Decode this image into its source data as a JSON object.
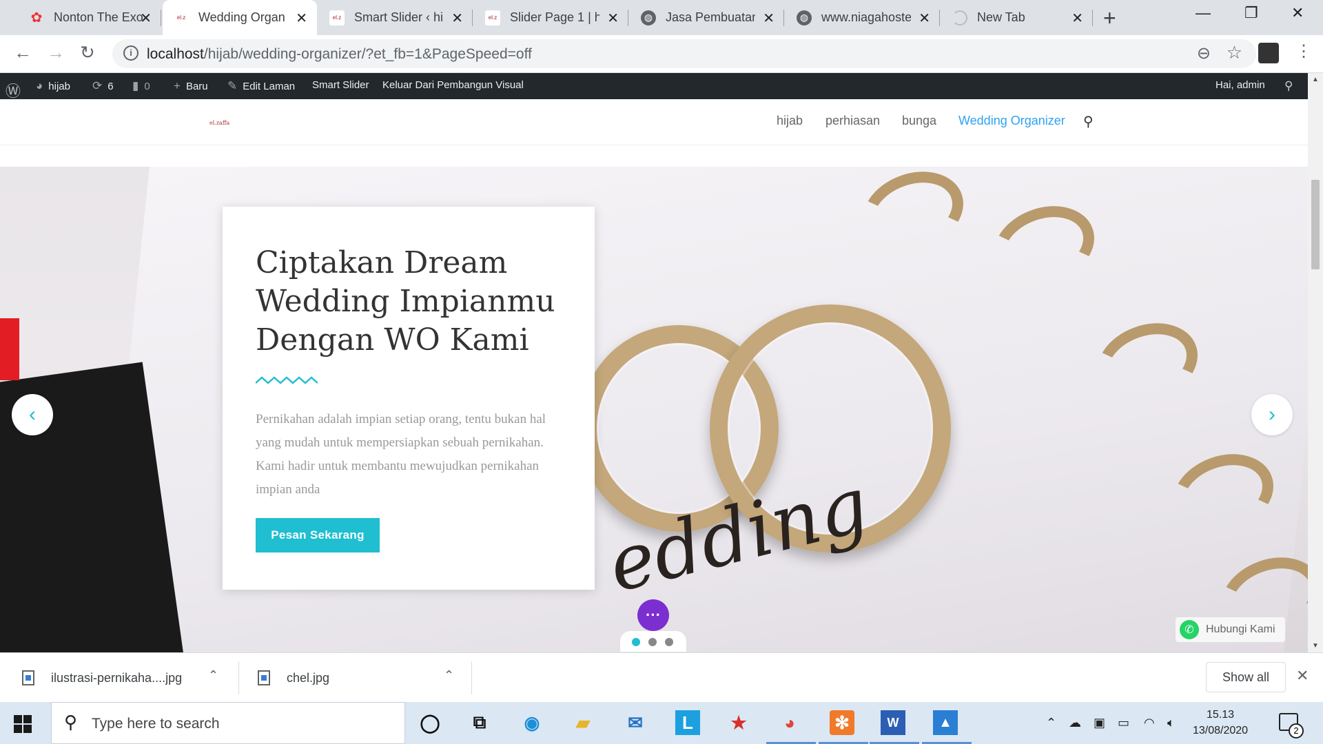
{
  "tabs": [
    {
      "title": "Nonton The Exo"
    },
    {
      "title": "Wedding Organ"
    },
    {
      "title": "Smart Slider ‹ hi"
    },
    {
      "title": "Slider Page 1 | h"
    },
    {
      "title": "Jasa Pembuatan"
    },
    {
      "title": "www.niagahoste"
    },
    {
      "title": "New Tab"
    }
  ],
  "address": {
    "host": "localhost",
    "path": "/hijab/wedding-organizer/?et_fb=1&PageSpeed=off"
  },
  "adminbar": {
    "site": "hijab",
    "updates": "6",
    "comments": "0",
    "new": "Baru",
    "edit": "Edit Laman",
    "smart_slider": "Smart Slider",
    "exit_builder": "Keluar Dari Pembangun Visual",
    "greeting": "Hai, admin"
  },
  "site": {
    "logo_text": "el.zaffa",
    "nav": [
      "hijab",
      "perhiasan",
      "bunga",
      "Wedding Organizer"
    ]
  },
  "hero": {
    "heading": "Ciptakan Dream Wedding Impianmu Dengan WO Kami",
    "body": "Pernikahan adalah impian setiap orang, tentu bukan hal yang mudah untuk mempersiapkan sebuah pernikahan. Kami hadir untuk membantu mewujudkan pernikahan impian anda",
    "cta": "Pesan Sekarang",
    "whatsapp": "Hubungi Kami",
    "active_slide": 1,
    "slide_count": 3
  },
  "downloads": [
    {
      "name": "ilustrasi-pernikaha....jpg"
    },
    {
      "name": "chel.jpg"
    }
  ],
  "show_all": "Show all",
  "taskbar": {
    "search_placeholder": "Type here to search",
    "time": "15.13",
    "date": "13/08/2020",
    "notifications": "2"
  },
  "colors": {
    "accent": "#1fbed0",
    "nav_active": "#2ea3f2",
    "admin_bar": "#23282d",
    "chat": "#7b2fd0"
  }
}
